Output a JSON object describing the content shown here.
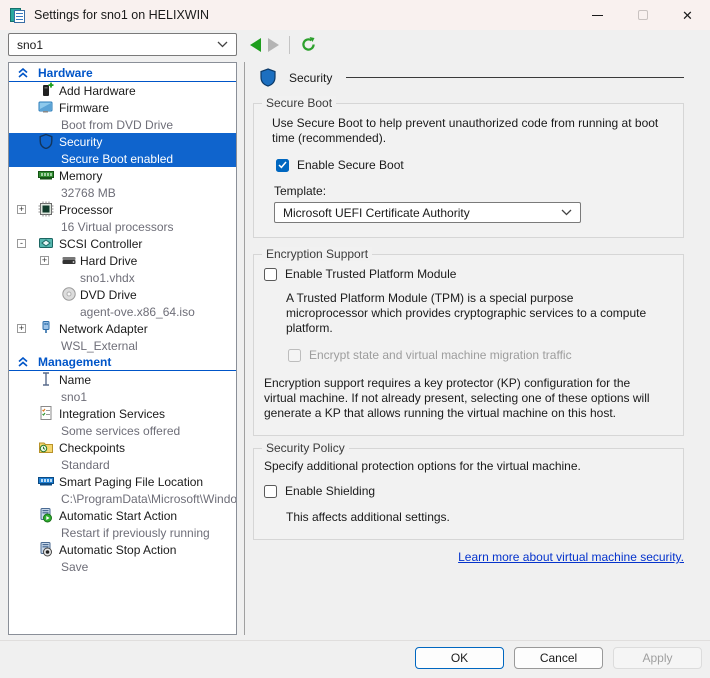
{
  "titlebar": {
    "title": "Settings for sno1 on HELIXWIN"
  },
  "toolbar": {
    "vm_selector_value": "sno1"
  },
  "colors": {
    "selection_blue": "#0f64cd",
    "section_header_blue": "#0055c8",
    "checkbox_accent": "#0067c0",
    "link_blue": "#0533cc",
    "back_arrow_green": "#1e9e1e",
    "refresh_green": "#2ca02c",
    "titlebar_bg": "#f9f1ef",
    "dialog_bg": "#f0f0f0"
  },
  "sidebar": {
    "sections": [
      {
        "header": "Hardware",
        "items": [
          {
            "icon": "add-hardware",
            "label": "Add Hardware"
          },
          {
            "icon": "firmware",
            "label": "Firmware",
            "sub": "Boot from DVD Drive"
          },
          {
            "icon": "security-shield",
            "label": "Security",
            "sub": "Secure Boot enabled",
            "selected": true
          },
          {
            "icon": "memory",
            "label": "Memory",
            "sub": "32768 MB"
          },
          {
            "icon": "processor",
            "label": "Processor",
            "sub": "16 Virtual processors",
            "expander": "+"
          },
          {
            "icon": "scsi-controller",
            "label": "SCSI Controller",
            "expander": "-"
          },
          {
            "icon": "hard-drive",
            "label": "Hard Drive",
            "sub": "sno1.vhdx",
            "expander": "+",
            "nested": true
          },
          {
            "icon": "dvd-drive",
            "label": "DVD Drive",
            "sub": "agent-ove.x86_64.iso",
            "nested": true
          },
          {
            "icon": "network-adapter",
            "label": "Network Adapter",
            "sub": "WSL_External",
            "expander": "+"
          }
        ]
      },
      {
        "header": "Management",
        "items": [
          {
            "icon": "name",
            "label": "Name",
            "sub": "sno1"
          },
          {
            "icon": "integration-services",
            "label": "Integration Services",
            "sub": "Some services offered"
          },
          {
            "icon": "checkpoints",
            "label": "Checkpoints",
            "sub": "Standard"
          },
          {
            "icon": "smart-paging",
            "label": "Smart Paging File Location",
            "sub": "C:\\ProgramData\\Microsoft\\Windo..."
          },
          {
            "icon": "auto-start",
            "label": "Automatic Start Action",
            "sub": "Restart if previously running"
          },
          {
            "icon": "auto-stop",
            "label": "Automatic Stop Action",
            "sub": "Save"
          }
        ]
      }
    ]
  },
  "main": {
    "title": "Security",
    "secure_boot": {
      "legend": "Secure Boot",
      "description": "Use Secure Boot to help prevent unauthorized code from running at boot time (recommended).",
      "checkbox_label": "Enable Secure Boot",
      "checkbox_checked": true,
      "template_label": "Template:",
      "template_value": "Microsoft UEFI Certificate Authority"
    },
    "encryption": {
      "legend": "Encryption Support",
      "tpm_checkbox_label": "Enable Trusted Platform Module",
      "tpm_checked": false,
      "tpm_description": "A Trusted Platform Module (TPM) is a special purpose microprocessor which provides cryptographic services to a compute platform.",
      "encrypt_checkbox_label": "Encrypt state and virtual machine migration traffic",
      "encrypt_checked": false,
      "encrypt_disabled": true,
      "kp_note": "Encryption support requires a key protector (KP) configuration for the virtual machine. If not already present, selecting one of these options will generate a KP that allows running the virtual machine on this host."
    },
    "policy": {
      "legend": "Security Policy",
      "description": "Specify additional protection options for the virtual machine.",
      "checkbox_label": "Enable Shielding",
      "checkbox_checked": false,
      "note": "This affects additional settings."
    },
    "link_text": "Learn more about virtual machine security."
  },
  "footer": {
    "ok": "OK",
    "cancel": "Cancel",
    "apply": "Apply",
    "apply_disabled": true
  }
}
